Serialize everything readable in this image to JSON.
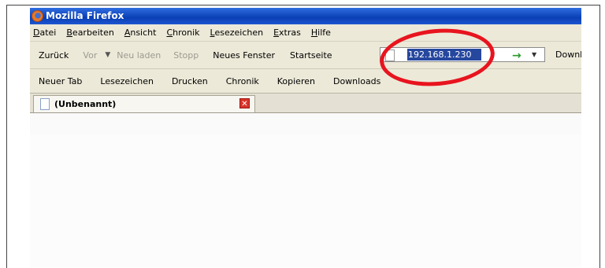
{
  "window": {
    "title": "Mozilla Firefox"
  },
  "menu": [
    "Datei",
    "Bearbeiten",
    "Ansicht",
    "Chronik",
    "Lesezeichen",
    "Extras",
    "Hilfe"
  ],
  "navigation": {
    "back": "Zurück",
    "forward": "Vor",
    "reload": "Neu laden",
    "stop": "Stopp",
    "new_window": "Neues Fenster",
    "home": "Startseite",
    "downloads_truncated": "Downl"
  },
  "address_bar": {
    "value": "192.168.1.230"
  },
  "bookmarks_toolbar": [
    "Neuer Tab",
    "Lesezeichen",
    "Drucken",
    "Chronik",
    "Kopieren",
    "Downloads"
  ],
  "tab": {
    "title": "(Unbenannt)"
  },
  "icons": {
    "app": "firefox-icon",
    "forward_dropdown": "chevron-down-icon",
    "page": "page-icon",
    "go": "go-arrow-icon",
    "tab_close": "close-icon"
  },
  "colors": {
    "annotation": "#e8141e",
    "titlebar": "#0a3fb5",
    "selection": "#26479e"
  }
}
